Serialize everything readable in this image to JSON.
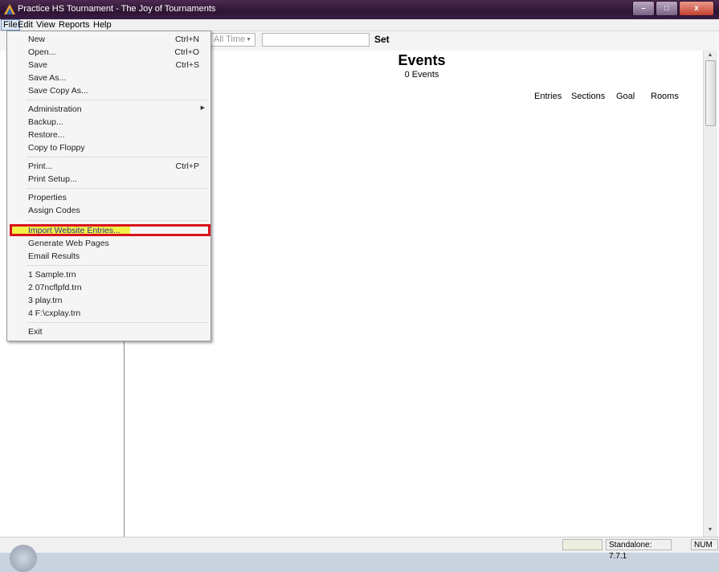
{
  "window": {
    "title": "Practice HS Tournament - The Joy of Tournaments",
    "buttons": {
      "minimize": "–",
      "maximize": "□",
      "close": "x"
    }
  },
  "menubar": {
    "items": [
      "File",
      "Edit",
      "View",
      "Reports",
      "Help"
    ]
  },
  "toolbar": {
    "time_filter": "All Time",
    "set_label": "Set"
  },
  "main": {
    "title": "Events",
    "count": "0 Events",
    "columns": [
      "Entries",
      "Sections",
      "Goal",
      "Rooms"
    ]
  },
  "file_menu": {
    "items": [
      {
        "label": "New",
        "shortcut": "Ctrl+N"
      },
      {
        "label": "Open...",
        "shortcut": "Ctrl+O"
      },
      {
        "label": "Save",
        "shortcut": "Ctrl+S"
      },
      {
        "label": "Save As...",
        "shortcut": ""
      },
      {
        "label": "Save Copy As...",
        "shortcut": ""
      },
      {
        "label": "Administration",
        "shortcut": ""
      },
      {
        "label": "Backup...",
        "shortcut": ""
      },
      {
        "label": "Restore...",
        "shortcut": ""
      },
      {
        "label": "Copy to Floppy",
        "shortcut": ""
      },
      {
        "label": "Print...",
        "shortcut": "Ctrl+P"
      },
      {
        "label": "Print Setup...",
        "shortcut": ""
      },
      {
        "label": "Properties",
        "shortcut": ""
      },
      {
        "label": "Assign Codes",
        "shortcut": ""
      },
      {
        "label": "Import Website Entries...",
        "shortcut": ""
      },
      {
        "label": "Generate Web Pages",
        "shortcut": ""
      },
      {
        "label": "Email Results",
        "shortcut": ""
      },
      {
        "label": "1 Sample.trn",
        "shortcut": ""
      },
      {
        "label": "2 07ncflpfd.trn",
        "shortcut": ""
      },
      {
        "label": "3 play.trn",
        "shortcut": ""
      },
      {
        "label": "4 F:\\cxplay.trn",
        "shortcut": ""
      },
      {
        "label": "Exit",
        "shortcut": ""
      }
    ]
  },
  "statusbar": {
    "version": "Standalone: 7.7.1",
    "num": "NUM"
  }
}
